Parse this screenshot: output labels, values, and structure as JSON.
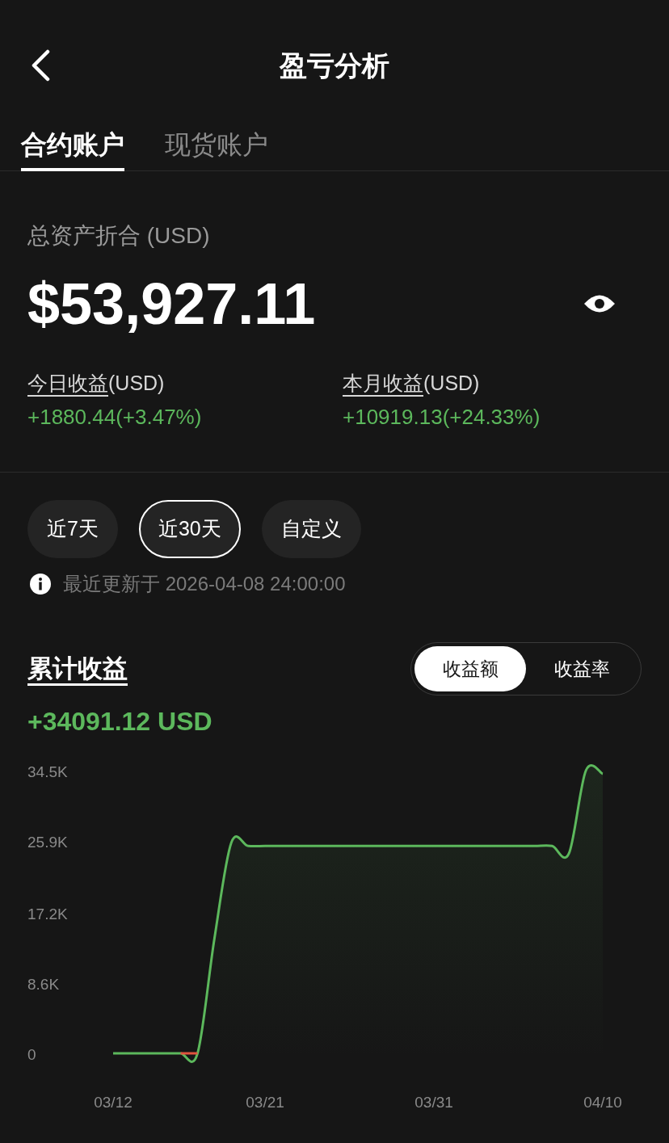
{
  "header": {
    "title": "盈亏分析"
  },
  "tabs": [
    {
      "label": "合约账户",
      "selected": true
    },
    {
      "label": "现货账户",
      "selected": false
    }
  ],
  "assets": {
    "label": "总资产折合 (USD)",
    "value": "$53,927.11"
  },
  "stats": [
    {
      "label": "今日收益",
      "unit": "(USD)",
      "value": "+1880.44(+3.47%)"
    },
    {
      "label": "本月收益",
      "unit": "(USD)",
      "value": "+10919.13(+24.33%)"
    }
  ],
  "ranges": [
    {
      "label": "近7天",
      "selected": false
    },
    {
      "label": "近30天",
      "selected": true
    },
    {
      "label": "自定义",
      "selected": false
    }
  ],
  "update_note": "最近更新于 2026-04-08 24:00:00",
  "section": {
    "title": "累计收益",
    "total": "+34091.12 USD"
  },
  "modes": [
    {
      "label": "收益额",
      "selected": true
    },
    {
      "label": "收益率",
      "selected": false
    }
  ],
  "chart_data": {
    "type": "area",
    "categories": [
      "03/12",
      null,
      null,
      null,
      null,
      null,
      null,
      null,
      null,
      "03/21",
      null,
      null,
      null,
      null,
      null,
      null,
      null,
      null,
      null,
      "03/31",
      null,
      null,
      null,
      null,
      null,
      null,
      null,
      null,
      null,
      "04/10"
    ],
    "yticks": [
      {
        "value": 0,
        "label": "0"
      },
      {
        "value": 8600,
        "label": "8.6K"
      },
      {
        "value": 17200,
        "label": "17.2K"
      },
      {
        "value": 25900,
        "label": "25.9K"
      },
      {
        "value": 34500,
        "label": "34.5K"
      }
    ],
    "ylim": [
      0,
      34500
    ],
    "series": [
      {
        "color": "#5cb85c",
        "values": [
          0,
          0,
          0,
          0,
          0,
          0,
          14000,
          25700,
          25300,
          25300,
          25300,
          25300,
          25300,
          25300,
          25300,
          25300,
          25300,
          25300,
          25300,
          25300,
          25300,
          25300,
          25300,
          25300,
          25300,
          25300,
          25300,
          24400,
          34500,
          34100
        ]
      }
    ]
  }
}
